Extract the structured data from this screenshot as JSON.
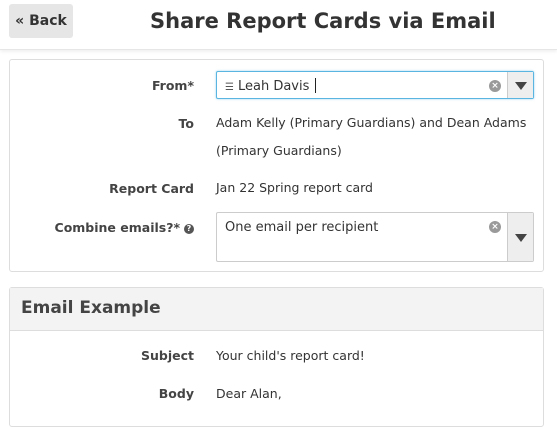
{
  "header": {
    "back_label": "« Back",
    "title": "Share Report Cards via Email"
  },
  "form": {
    "from": {
      "label": "From*",
      "value": "Leah Davis",
      "icon": "graduation-cap-icon"
    },
    "to": {
      "label": "To",
      "value_line1": "Adam Kelly (Primary Guardians) and Dean Adams",
      "value_line2": "(Primary Guardians)"
    },
    "report_card": {
      "label": "Report Card",
      "value": "Jan 22 Spring report card"
    },
    "combine": {
      "label": "Combine emails?*",
      "help_icon": "?",
      "value": "One email per recipient"
    }
  },
  "email_example": {
    "title": "Email Example",
    "subject_label": "Subject",
    "subject_value": "Your child's report card!",
    "body_label": "Body",
    "body_value": "Dear Alan,"
  },
  "colors": {
    "focus_border": "#5ab6e0",
    "button_bg": "#e6e6e6",
    "panel_head_bg": "#f3f3f3"
  }
}
